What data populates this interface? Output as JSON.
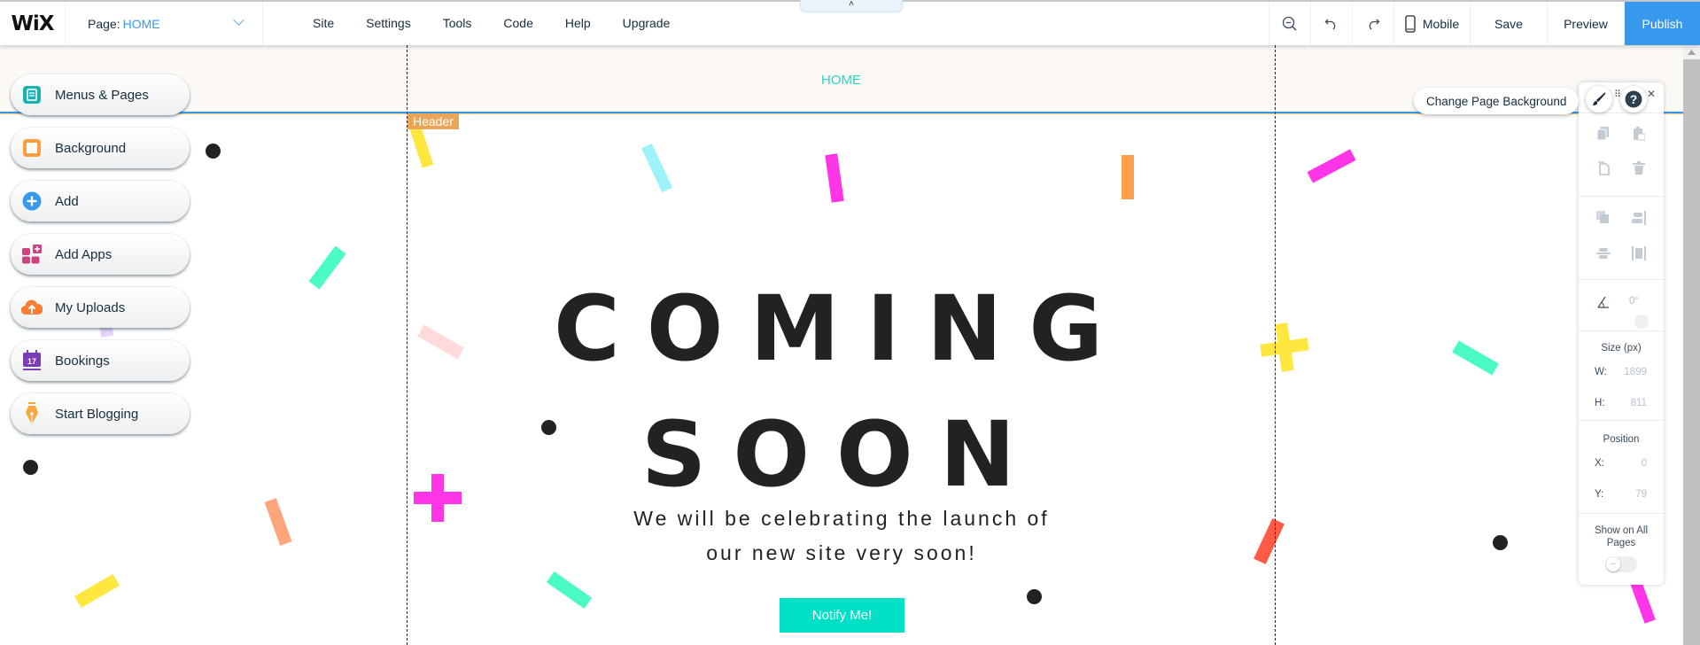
{
  "topbar": {
    "logo": "WiX",
    "page_label": "Page:",
    "page_value": "HOME",
    "menus": [
      "Site",
      "Settings",
      "Tools",
      "Code",
      "Help",
      "Upgrade"
    ],
    "collapse_glyph": "˄",
    "tools": {
      "zoom_out": "zoom-out",
      "undo": "undo",
      "redo": "redo"
    },
    "mobile_label": "Mobile",
    "save_label": "Save",
    "preview_label": "Preview",
    "publish_label": "Publish",
    "publish_color": "#3899ec"
  },
  "left_panel": {
    "items": [
      {
        "label": "Menus & Pages",
        "icon": "pages-icon",
        "color": "#1ab1b0"
      },
      {
        "label": "Background",
        "icon": "background-icon",
        "color": "#ff9d3b"
      },
      {
        "label": "Add",
        "icon": "add-icon",
        "color": "#3899ec"
      },
      {
        "label": "Add Apps",
        "icon": "apps-icon",
        "color": "#d0427f"
      },
      {
        "label": "My Uploads",
        "icon": "upload-icon",
        "color": "#fb7d33"
      },
      {
        "label": "Bookings",
        "icon": "calendar-icon",
        "color": "#7a3cb6"
      },
      {
        "label": "Start Blogging",
        "icon": "pen-icon",
        "color": "#f8a83c"
      }
    ],
    "bookings_day": "17"
  },
  "stage": {
    "header_nav_item": "HOME",
    "header_tag": "Header",
    "title_line1": "COMING",
    "title_line2": "SOON",
    "subtitle_line1": "We will be celebrating the launch of",
    "subtitle_line2": "our new site very soon!",
    "cta_label": "Notify Me!",
    "cta_color": "#00e0c6",
    "home_color": "#2ad8c8"
  },
  "floating": {
    "change_bg_label": "Change Page Background"
  },
  "right_panel": {
    "rotation_value": "0°",
    "size_label": "Size (px)",
    "w_label": "W:",
    "w_value": "1899",
    "h_label": "H:",
    "h_value": "811",
    "position_label": "Position",
    "x_label": "X:",
    "x_value": "0",
    "y_label": "Y:",
    "y_value": "79",
    "show_all_label": "Show on All Pages",
    "show_all_enabled": false
  }
}
